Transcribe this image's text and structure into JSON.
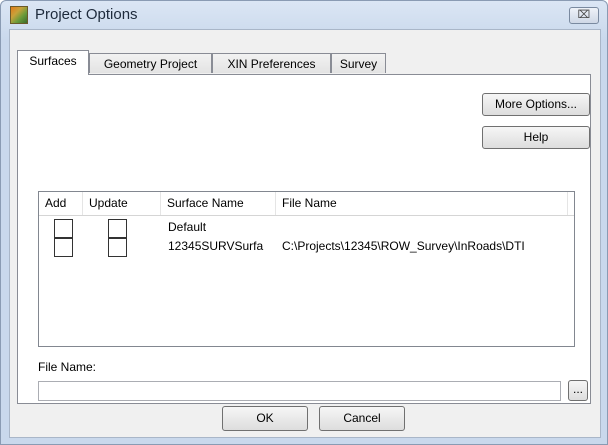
{
  "window": {
    "title": "Project Options",
    "close_glyph": "⌧"
  },
  "tabs": [
    {
      "label": "Surfaces",
      "active": true
    },
    {
      "label": "Geometry Project",
      "active": false
    },
    {
      "label": "XIN Preferences",
      "active": false
    },
    {
      "label": "Survey",
      "active": false
    }
  ],
  "buttons": {
    "more_options": "More Options...",
    "help": "Help",
    "browse": "...",
    "ok": "OK",
    "cancel": "Cancel"
  },
  "table": {
    "headers": [
      "Add",
      "Update",
      "Surface Name",
      "File Name"
    ],
    "rows": [
      {
        "add": false,
        "update": false,
        "surface_name": "Default",
        "file_name": ""
      },
      {
        "add": false,
        "update": false,
        "surface_name": "12345SURVSurfa",
        "file_name": "C:\\Projects\\12345\\ROW_Survey\\InRoads\\DTI"
      }
    ]
  },
  "file_name": {
    "label": "File Name:",
    "value": "",
    "placeholder": ""
  }
}
